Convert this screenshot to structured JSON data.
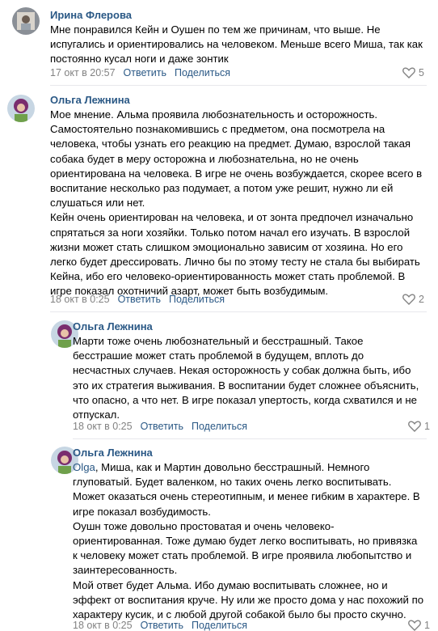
{
  "comments": [
    {
      "author": "Ирина Флерова",
      "lines": [
        "Мне понравился Кейн и Оушен по тем же причинам, что выше. Не",
        "испугались и ориентировались на человеком. Меньше всего Миша, так как",
        "постоянно кусал ноги и даже зонтик"
      ],
      "date": "17 окт в 20:57",
      "reply": "Ответить",
      "share": "Поделиться",
      "likes": "5"
    },
    {
      "author": "Ольга Лежнина",
      "lines": [
        "Мое мнение. Альма проявила любознательность и осторожность.",
        "Самостоятельно познакомившись с предметом, она посмотрела на",
        "человека, чтобы узнать его реакцию на предмет. Думаю, взрослой такая",
        "собака будет в меру осторожна и любознательна, но не очень",
        "ориентирована на человека. В игре не очень возбуждается, скорее всего в",
        "воспитание несколько раз подумает, а потом уже решит, нужно ли ей",
        "слушаться или нет.",
        "Кейн очень ориентирован на человека, и от зонта предпочел изначально",
        "спрятаться за ноги хозяйки. Только потом начал его изучать. В взрослой",
        "жизни может стать слишком эмоционально зависим от хозяина. Но его",
        "легко будет дрессировать. Лично бы по этому тесту не стала бы выбирать",
        "Кейна, ибо его человеко-ориентированность может стать проблемой. В",
        "игре показал охотничий азарт, может быть возбудимым."
      ],
      "date": "18 окт в 0:25",
      "reply": "Ответить",
      "share": "Поделиться",
      "likes": "2"
    },
    {
      "author": "Ольга Лежнина",
      "lines": [
        "Марти тоже очень любознательный и бесстрашный. Такое",
        "бесстрашие может стать проблемой в будущем, вплоть до",
        "несчастных случаев. Некая осторожность у собак должна быть, ибо",
        "это их стратегия выживания. В воспитании будет сложнее объяснить,",
        "что опасно, а что нет. В игре показал упертость, когда схватился и не",
        "отпускал."
      ],
      "date": "18 окт в 0:25",
      "reply": "Ответить",
      "share": "Поделиться",
      "likes": "1"
    },
    {
      "author": "Ольга Лежнина",
      "mention": "Olga",
      "lines": [
        ", Миша, как и Мартин довольно бесстрашный. Немного",
        "глуповатый. Будет валенком, но таких очень легко воспитывать.",
        "Может оказаться очень стереотипным, и менее гибким в характере. В",
        "игре показал возбудимость.",
        "Оушн тоже довольно простоватая и очень человеко-",
        "ориентированная. Тоже думаю будет легко воспитывать, но привязка",
        "к человеку может стать проблемой. В игре проявила любопытство и",
        "заинтересованность.",
        "Мой ответ будет Альма. Ибо думаю воспитывать сложнее, но и",
        "эффект от воспитания круче. Ну или же просто дома у нас похожий по",
        "характеру кусик, и с любой другой собакой было бы просто скучно."
      ],
      "date": "18 окт в 0:25",
      "reply": "Ответить",
      "share": "Поделиться",
      "likes": "1"
    }
  ],
  "colors": {
    "link": "#2a5885",
    "meta": "#828282",
    "divider": "#e7e8ec"
  },
  "icons": {
    "like": "heart-icon"
  }
}
